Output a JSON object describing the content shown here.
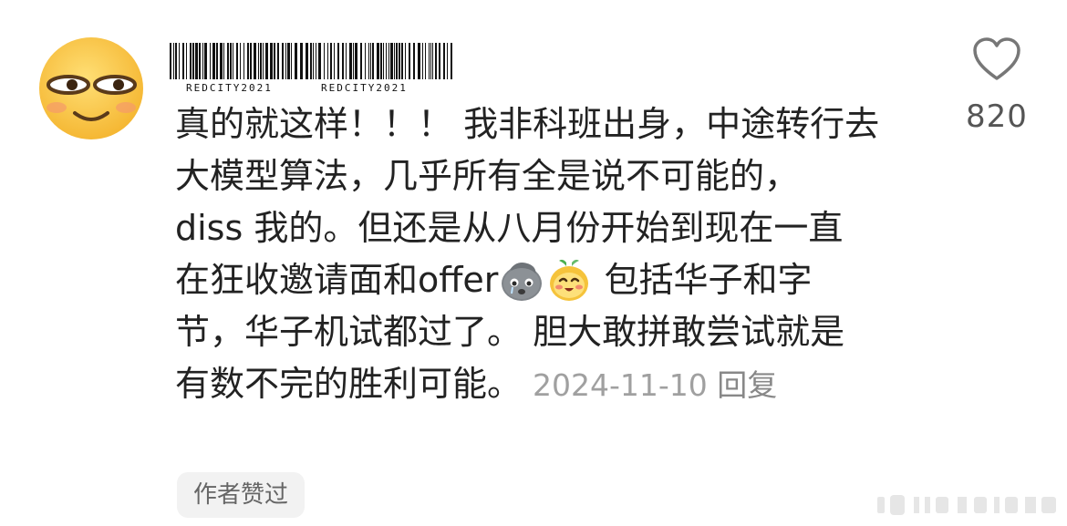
{
  "comment": {
    "username_watermark": "REDCITY2021",
    "segments": [
      "真的就这样！！！ 我非科班出身，中途转行去",
      "大模型算法，几乎所有全是说不可能的，",
      "diss 我的。但还是从八月份开始到现在一直",
      "在狂收邀请面和offer",
      " 包括华子和字",
      "节，华子机试都过了。 胆大敢拼敢尝试就是",
      "有数不完的胜利可能。"
    ],
    "emojis": [
      "crying-rock-emoji-icon",
      "happy-radish-emoji-icon"
    ],
    "date": "2024-11-10",
    "reply_label": "回复"
  },
  "like": {
    "count": "820",
    "icon": "heart-outline-icon"
  },
  "badge": {
    "author_liked": "作者赞过"
  },
  "colors": {
    "text": "#222222",
    "meta": "#a0a0a0",
    "badge_bg": "#f2f2f2",
    "avatar": "#fcc64a"
  }
}
